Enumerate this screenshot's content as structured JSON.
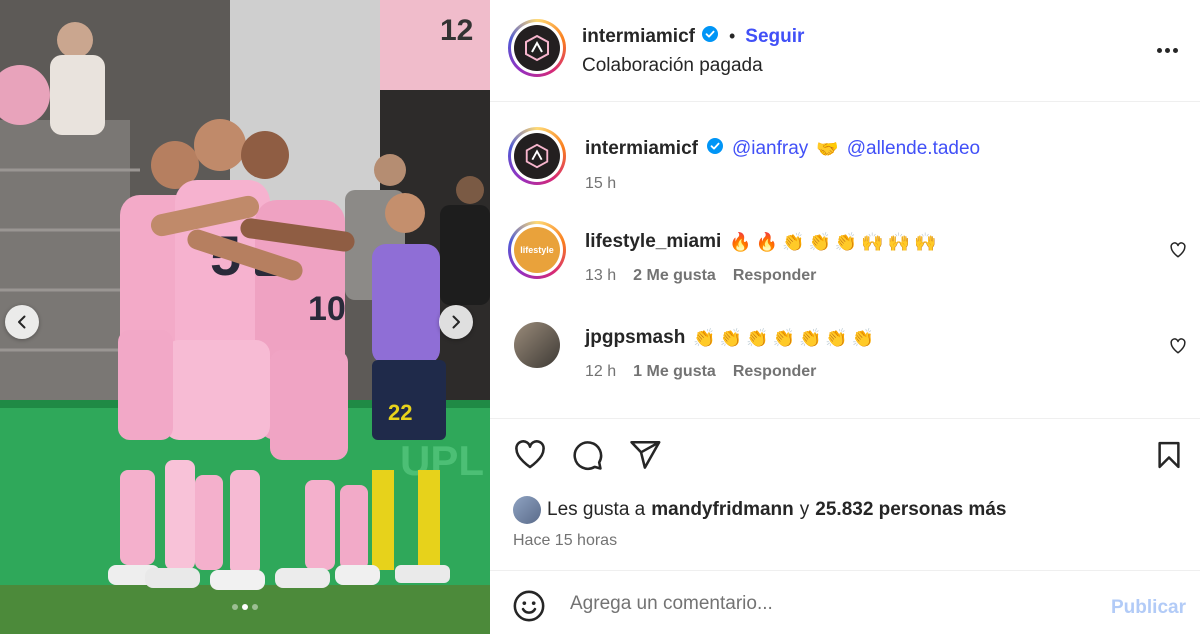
{
  "media": {
    "jersey_number": "5",
    "jersey_number_2": "10",
    "sign_text": "12",
    "carousel_dots": 3,
    "carousel_active_dot": 2
  },
  "header": {
    "username": "intermiamicf",
    "separator": "•",
    "follow_label": "Seguir",
    "subtitle": "Colaboración pagada"
  },
  "comments": [
    {
      "username": "intermiamicf",
      "mentions": [
        "@ianfray",
        "@allende.tadeo"
      ],
      "handshake": "🤝",
      "time": "15 h"
    },
    {
      "username": "lifestyle_miami",
      "avatar_text": "lifestyle",
      "emojis": "🔥🔥👏👏👏🙌🙌🙌",
      "time": "13 h",
      "likes": "2 Me gusta",
      "reply": "Responder"
    },
    {
      "username": "jpgpsmash",
      "emojis": "👏👏👏👏👏👏👏",
      "time": "12 h",
      "likes": "1 Me gusta",
      "reply": "Responder"
    }
  ],
  "likes": {
    "prefix": "Les gusta a",
    "user": "mandyfridmann",
    "connector": "y",
    "count": "25.832 personas más"
  },
  "timeago": "Hace 15 horas",
  "add_comment": {
    "placeholder": "Agrega un comentario...",
    "publish": "Publicar"
  },
  "colors": {
    "link_blue": "#4150f7",
    "publish_disabled": "#b2cbf7",
    "jersey_pink": "#f3aac8"
  }
}
